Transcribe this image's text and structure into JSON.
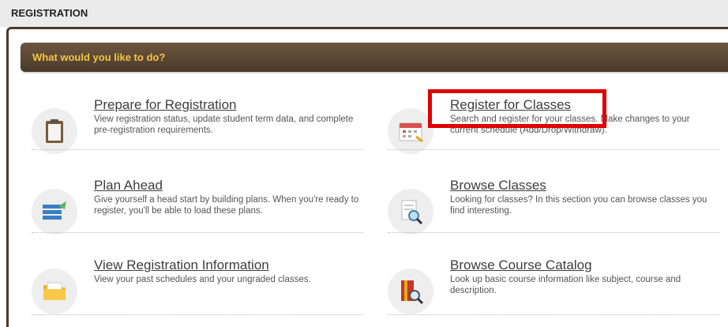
{
  "header": {
    "title": "REGISTRATION"
  },
  "banner": {
    "text": "What would you like to do?"
  },
  "tiles": [
    {
      "title": "Prepare for Registration",
      "desc": "View registration status, update student term data, and complete pre-registration requirements."
    },
    {
      "title": "Register for Classes",
      "desc": "Search and register for your classes. Make changes to your current schedule (Add/Drop/Withdraw)."
    },
    {
      "title": "Plan Ahead",
      "desc": "Give yourself a head start by building plans. When you're ready to register, you'll be able to load these plans."
    },
    {
      "title": "Browse Classes",
      "desc": "Looking for classes? In this section you can browse classes you find interesting."
    },
    {
      "title": "View Registration Information",
      "desc": "View your past schedules and your ungraded classes."
    },
    {
      "title": "Browse Course Catalog",
      "desc": "Look up basic course information like subject, course and description."
    }
  ],
  "colors": {
    "banner_text": "#f5c542",
    "banner_bg": "#5a4734",
    "highlight": "#e00000"
  }
}
